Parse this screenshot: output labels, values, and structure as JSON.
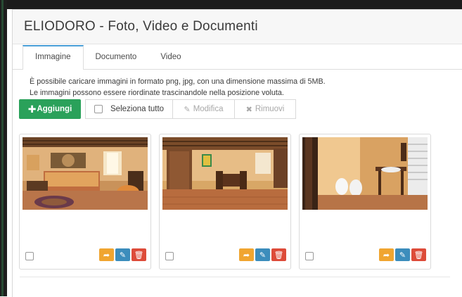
{
  "panel": {
    "title": "ELIODORO - Foto, Video e Documenti"
  },
  "tabs": [
    {
      "label": "Immagine",
      "active": true
    },
    {
      "label": "Documento",
      "active": false
    },
    {
      "label": "Video",
      "active": false
    }
  ],
  "info": {
    "line1": "È possibile caricare immagini in formato png, jpg, con una dimensione massima di 5MB.",
    "line2": "Le immagini possono essere riordinate trascinandole nella posizione voluta."
  },
  "toolbar": {
    "add_label": "Aggiungi",
    "select_all_label": "Seleziona tutto",
    "edit_label": "Modifica",
    "remove_label": "Rimuovi"
  },
  "images": [
    {
      "subject": "bedroom",
      "checked": false
    },
    {
      "subject": "living room",
      "checked": false
    },
    {
      "subject": "bathroom",
      "checked": false
    }
  ],
  "colors": {
    "add_button": "#2aa15a",
    "share_button": "#f0a530",
    "edit_button": "#3c8dbc",
    "delete_button": "#dd4b39",
    "active_tab_accent": "#4a9fd8"
  },
  "icons": {
    "add": "plus-icon",
    "edit": "pencil-icon",
    "remove": "x-icon",
    "share": "share-arrow-icon",
    "image_edit": "pencil-icon",
    "image_delete": "trash-icon"
  }
}
